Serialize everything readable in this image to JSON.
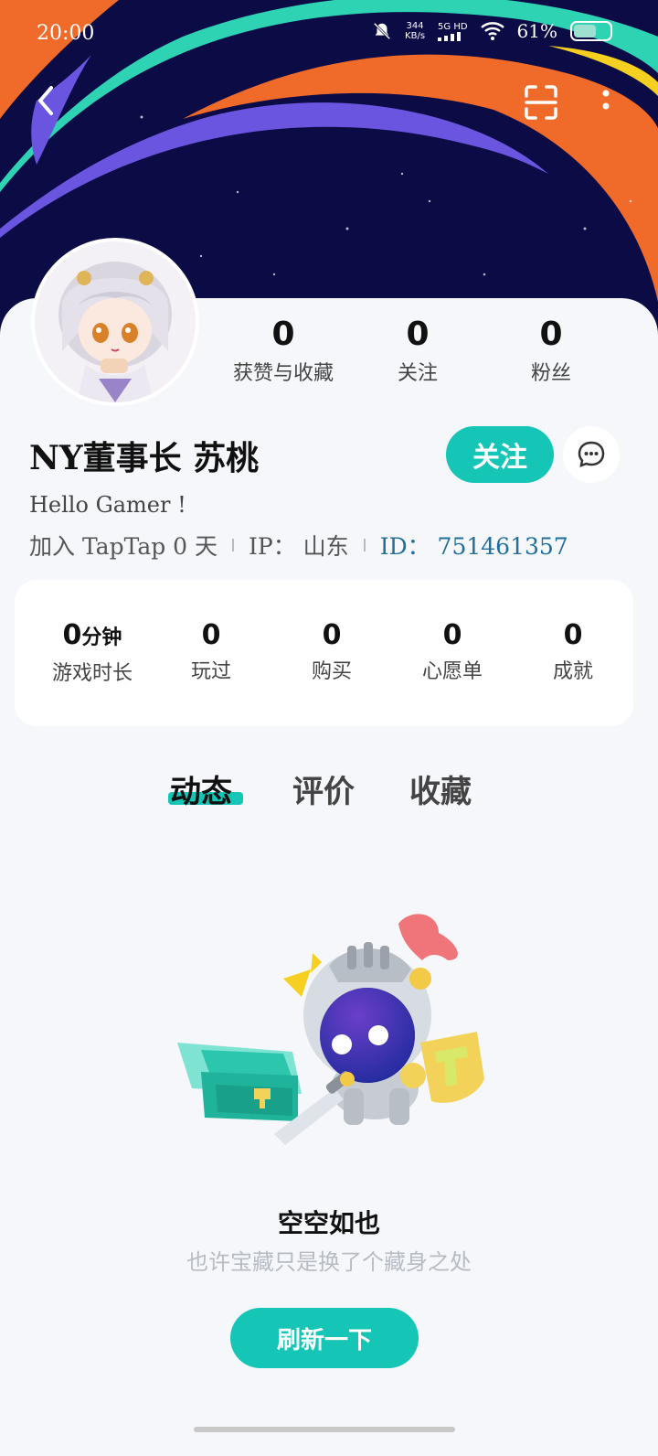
{
  "status_bar": {
    "time": "20:00",
    "speed_value": "344",
    "speed_unit": "KB/s",
    "network": "5G HD",
    "battery": "61%"
  },
  "header": {
    "back_icon": "chevron-left-icon",
    "scan_icon": "scan-icon",
    "more_icon": "more-vertical-icon"
  },
  "profile": {
    "top_stats": [
      {
        "value": "0",
        "label": "获赞与收藏"
      },
      {
        "value": "0",
        "label": "关注"
      },
      {
        "value": "0",
        "label": "粉丝"
      }
    ],
    "nickname": "NY董事长 苏桃",
    "follow_label": "关注",
    "bio": "Hello Gamer !",
    "joined": "加入 TapTap 0 天",
    "ip": "IP： 山东",
    "id": "ID： 751461357"
  },
  "game_stats": [
    {
      "value": "0",
      "unit": "分钟",
      "label": "游戏时长"
    },
    {
      "value": "0",
      "unit": "",
      "label": "玩过"
    },
    {
      "value": "0",
      "unit": "",
      "label": "购买"
    },
    {
      "value": "0",
      "unit": "",
      "label": "心愿单"
    },
    {
      "value": "0",
      "unit": "",
      "label": "成就"
    }
  ],
  "tabs": [
    {
      "label": "动态",
      "active": true
    },
    {
      "label": "评价",
      "active": false
    },
    {
      "label": "收藏",
      "active": false
    }
  ],
  "empty_state": {
    "title": "空空如也",
    "subtitle": "也许宝藏只是换了个藏身之处",
    "refresh_label": "刷新一下"
  },
  "colors": {
    "accent": "#15c5b6",
    "banner_bg": "#0b0b45",
    "id_link": "#1f6e9c"
  }
}
